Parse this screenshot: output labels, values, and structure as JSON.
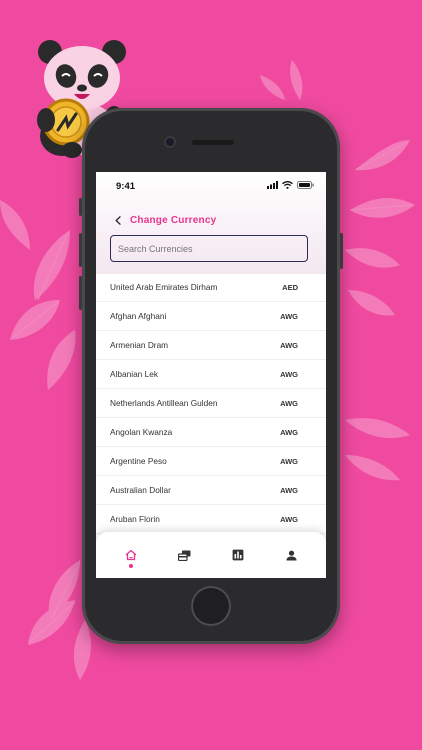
{
  "status_bar": {
    "time": "9:41"
  },
  "header": {
    "title": "Change Currency"
  },
  "search": {
    "placeholder": "Search Currencies",
    "value": ""
  },
  "currencies": [
    {
      "name": "United Arab Emirates Dirham",
      "code": "AED"
    },
    {
      "name": "Afghan Afghani",
      "code": "AWG"
    },
    {
      "name": "Armenian Dram",
      "code": "AWG"
    },
    {
      "name": "Albanian Lek",
      "code": "AWG"
    },
    {
      "name": "Netherlands Antillean Gulden",
      "code": "AWG"
    },
    {
      "name": "Angolan Kwanza",
      "code": "AWG"
    },
    {
      "name": "Argentine Peso",
      "code": "AWG"
    },
    {
      "name": "Australian Dollar",
      "code": "AWG"
    },
    {
      "name": "Aruban Florin",
      "code": "AWG"
    }
  ],
  "tab_bar": {
    "active": "home",
    "tabs": [
      "home-icon",
      "cards-icon",
      "report-icon",
      "profile-icon"
    ]
  },
  "colors": {
    "background": "#f04aa0",
    "accent": "#e8338f",
    "text": "#333333"
  }
}
